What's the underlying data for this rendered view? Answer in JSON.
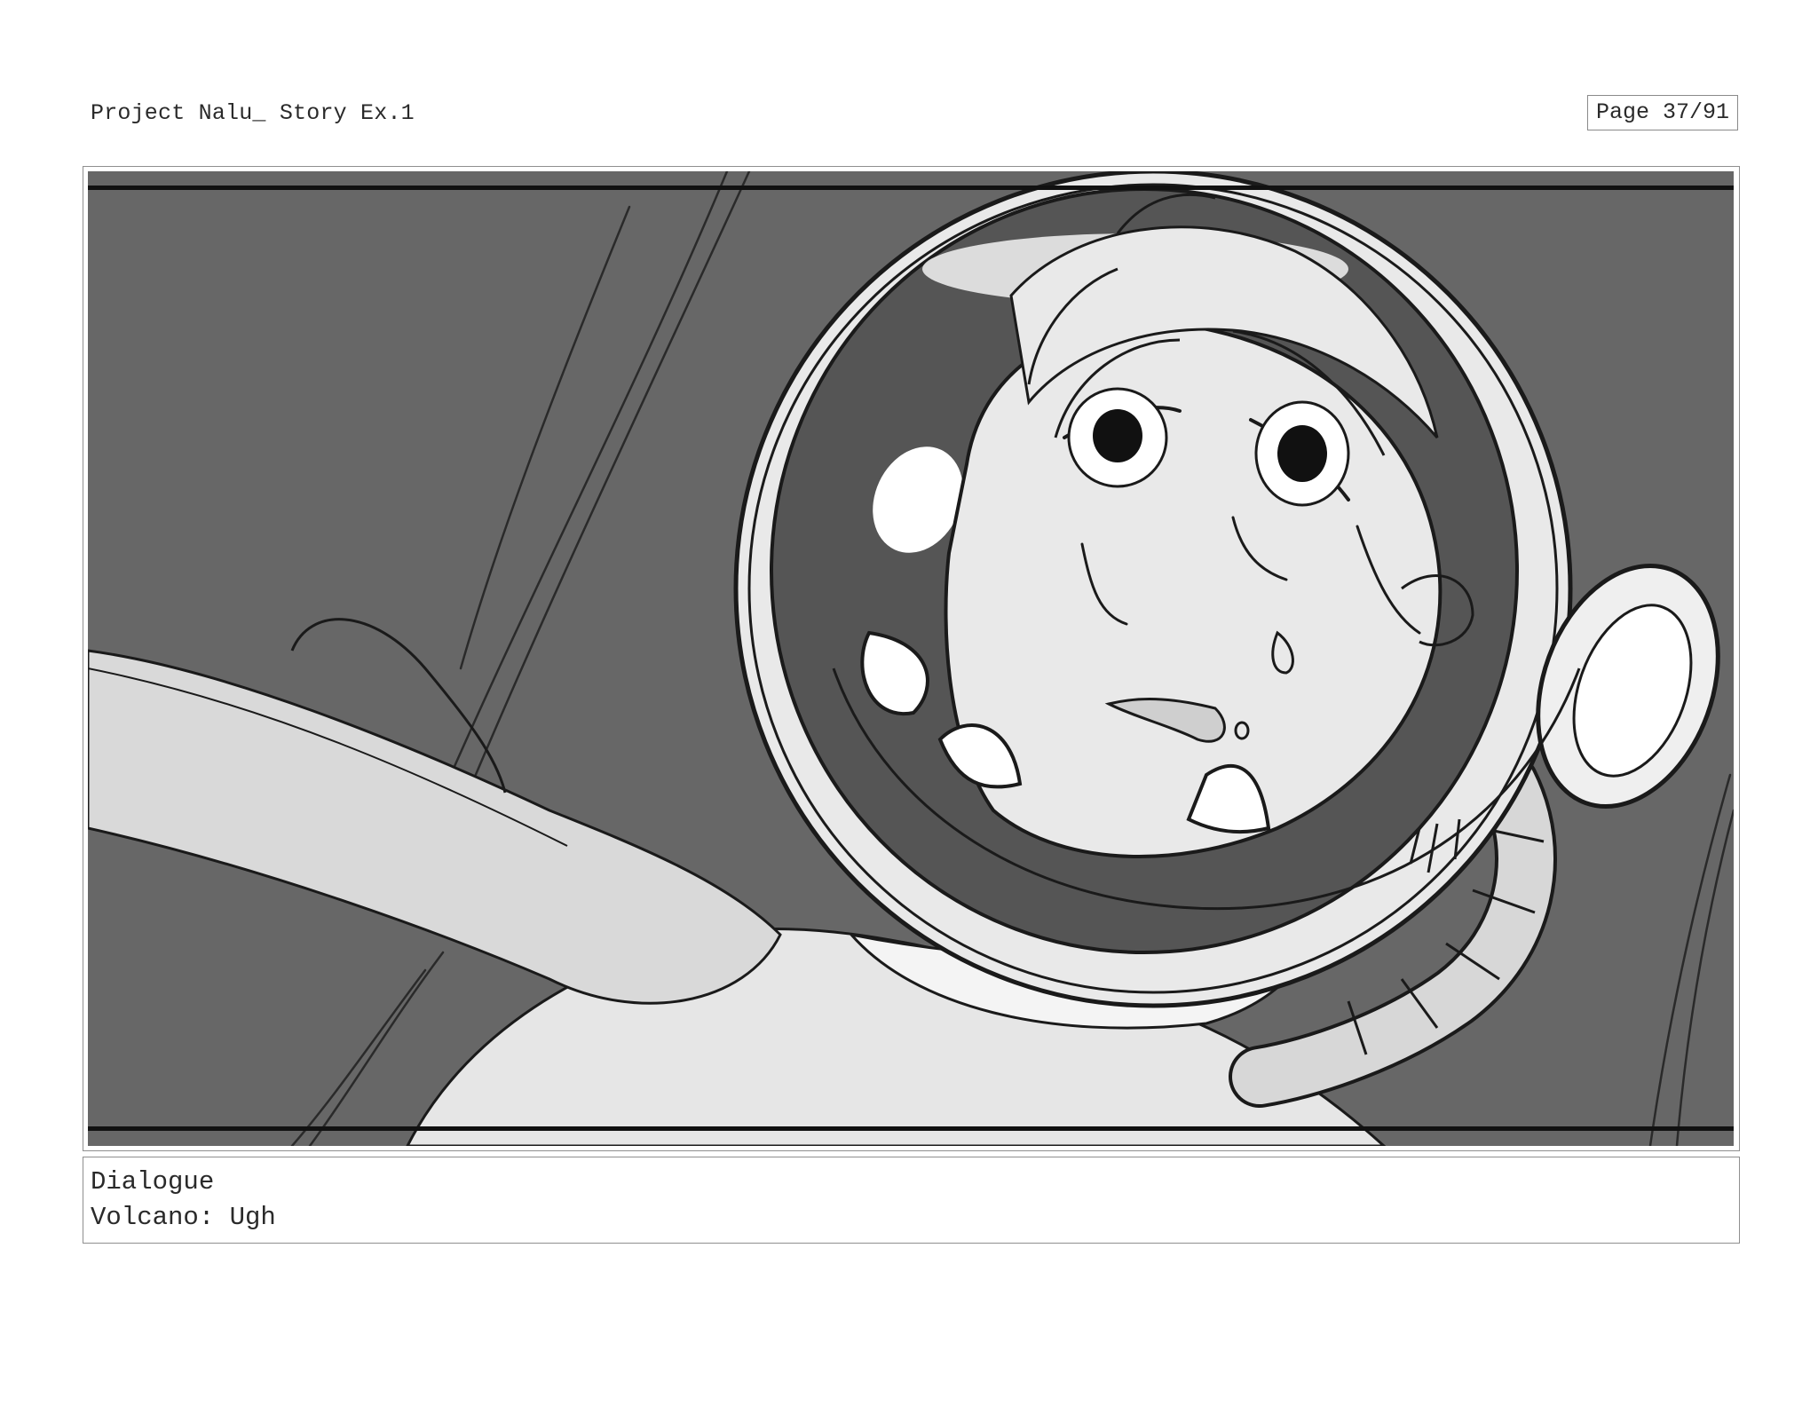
{
  "header": {
    "project_title": "Project Nalu_ Story Ex.1",
    "page_counter": "Page 37/91"
  },
  "panel": {
    "icon": "storyboard-sketch-astronaut-helmet",
    "colors": {
      "background": "#676767",
      "light": "#e4e4e4",
      "white": "#ffffff",
      "ink": "#1a1a1a"
    }
  },
  "dialogue": {
    "heading": "Dialogue",
    "line": "Volcano: Ugh"
  }
}
